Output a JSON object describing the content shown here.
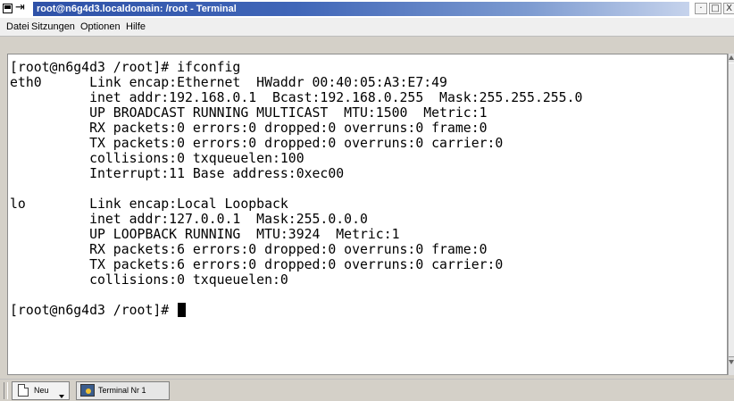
{
  "window": {
    "title": "root@n6g4d3.localdomain: /root - Terminal",
    "pin_glyph": "⇥",
    "buttons": {
      "minimize": "·",
      "maximize": "□",
      "close": "X"
    }
  },
  "menubar": {
    "items": [
      "Datei",
      "Sitzungen",
      "Optionen",
      "Hilfe"
    ]
  },
  "terminal": {
    "lines": [
      "[root@n6g4d3 /root]# ifconfig",
      "eth0      Link encap:Ethernet  HWaddr 00:40:05:A3:E7:49",
      "          inet addr:192.168.0.1  Bcast:192.168.0.255  Mask:255.255.255.0",
      "          UP BROADCAST RUNNING MULTICAST  MTU:1500  Metric:1",
      "          RX packets:0 errors:0 dropped:0 overruns:0 frame:0",
      "          TX packets:0 errors:0 dropped:0 overruns:0 carrier:0",
      "          collisions:0 txqueuelen:100",
      "          Interrupt:11 Base address:0xec00",
      "",
      "lo        Link encap:Local Loopback",
      "          inet addr:127.0.0.1  Mask:255.0.0.0",
      "          UP LOOPBACK RUNNING  MTU:3924  Metric:1",
      "          RX packets:6 errors:0 dropped:0 overruns:0 frame:0",
      "          TX packets:6 errors:0 dropped:0 overruns:0 carrier:0",
      "          collisions:0 txqueuelen:0",
      ""
    ],
    "prompt": "[root@n6g4d3 /root]# "
  },
  "tabbar": {
    "new_label": "Neu",
    "terminal_tab_label": "Terminal Nr 1"
  },
  "colors": {
    "titlebar_active": "#2f52a8",
    "terminal_background": "#ffffff",
    "terminal_foreground": "#000000"
  }
}
